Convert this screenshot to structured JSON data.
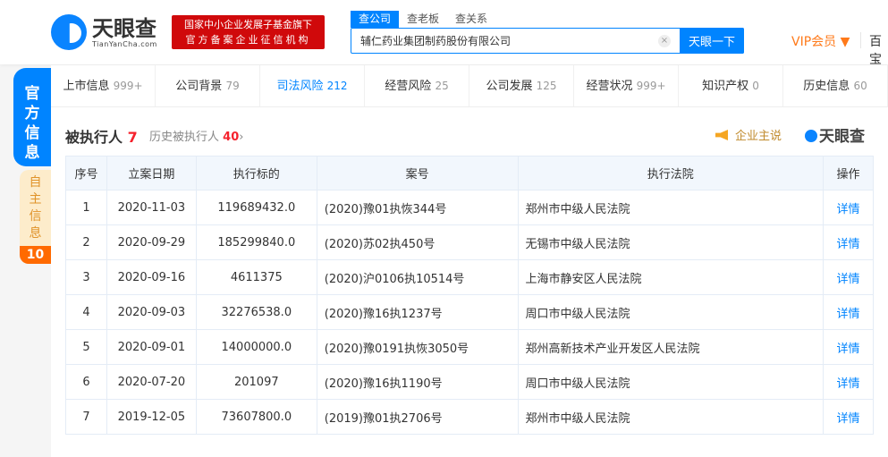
{
  "header": {
    "logo_cn": "天眼查",
    "logo_en": "TianYanCha.com",
    "badge_line1": "国家中小企业发展子基金旗下",
    "badge_line2": "官方备案企业征信机构",
    "search_tabs": [
      "查公司",
      "查老板",
      "查关系"
    ],
    "search_value": "辅仁药业集团制药股份有限公司",
    "clear_icon": "×",
    "search_button": "天眼一下",
    "vip": "VIP会员 ▼",
    "more": "百宝"
  },
  "sidebar": {
    "official": [
      "官",
      "方",
      "信",
      "息"
    ],
    "self": [
      "自",
      "主",
      "信",
      "息"
    ],
    "self_count": "10"
  },
  "tabs": [
    {
      "label": "上市信息",
      "count": "999+"
    },
    {
      "label": "公司背景",
      "count": "79"
    },
    {
      "label": "司法风险",
      "count": "212"
    },
    {
      "label": "经营风险",
      "count": "25"
    },
    {
      "label": "公司发展",
      "count": "125"
    },
    {
      "label": "经营状况",
      "count": "999+"
    },
    {
      "label": "知识产权",
      "count": "0"
    },
    {
      "label": "历史信息",
      "count": "60"
    }
  ],
  "section": {
    "title": "被执行人",
    "count": "7",
    "history_label": "历史被执行人",
    "history_count": "40",
    "chevron": "›",
    "say": "企业主说",
    "brand": "天眼查"
  },
  "table": {
    "headers": [
      "序号",
      "立案日期",
      "执行标的",
      "案号",
      "执行法院",
      "操作"
    ],
    "rows": [
      [
        "1",
        "2020-11-03",
        "119689432.0",
        "(2020)豫01执恢344号",
        "郑州市中级人民法院",
        "详情"
      ],
      [
        "2",
        "2020-09-29",
        "185299840.0",
        "(2020)苏02执450号",
        "无锡市中级人民法院",
        "详情"
      ],
      [
        "3",
        "2020-09-16",
        "4611375",
        "(2020)沪0106执10514号",
        "上海市静安区人民法院",
        "详情"
      ],
      [
        "4",
        "2020-09-03",
        "32276538.0",
        "(2020)豫16执1237号",
        "周口市中级人民法院",
        "详情"
      ],
      [
        "5",
        "2020-09-01",
        "14000000.0",
        "(2020)豫0191执恢3050号",
        "郑州高新技术产业开发区人民法院",
        "详情"
      ],
      [
        "6",
        "2020-07-20",
        "201097",
        "(2020)豫16执1190号",
        "周口市中级人民法院",
        "详情"
      ],
      [
        "7",
        "2019-12-05",
        "73607800.0",
        "(2019)豫01执2706号",
        "郑州市中级人民法院",
        "详情"
      ]
    ]
  }
}
